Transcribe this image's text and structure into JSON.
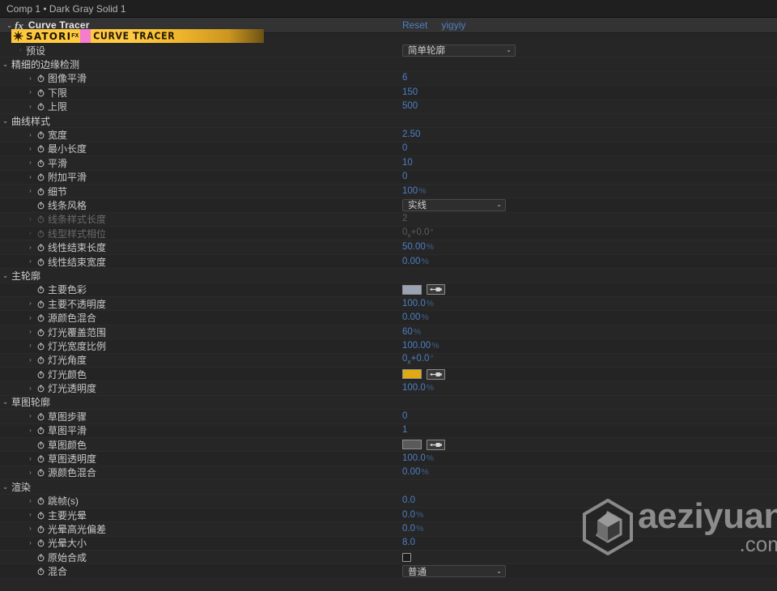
{
  "panel": {
    "title": "Comp 1 • Dark Gray Solid 1"
  },
  "effect": {
    "name": "Curve Tracer",
    "fx_glyph": "fx",
    "twirl": "⌄",
    "reset_label": "Reset",
    "author_label": "yigyiy"
  },
  "banner": {
    "brand": "SATORI",
    "brand_sup": "FX",
    "product": "CURVE TRACER",
    "gold": "#ffc83c",
    "pink": "#f47ecb"
  },
  "colors": {
    "value_blue": "#4f7fc4",
    "main_color_swatch": "#9aa3b4",
    "light_color_swatch": "#e0aa12",
    "sketch_color_swatch": "#5a5a5a"
  },
  "rows": [
    {
      "label": "预设",
      "indent": 1,
      "caret": "",
      "arrow": "",
      "stopwatch": false,
      "type": "dropdown",
      "value": "简单轮廓",
      "width": "wide"
    },
    {
      "label": "精细的边缘检测",
      "indent": 0,
      "caret": "⌄",
      "arrow": "",
      "stopwatch": false,
      "type": "group",
      "value": ""
    },
    {
      "label": "图像平滑",
      "indent": 2,
      "arrow": "›",
      "stopwatch": true,
      "type": "number",
      "value": "6"
    },
    {
      "label": "下限",
      "indent": 2,
      "arrow": "›",
      "stopwatch": true,
      "type": "number",
      "value": "150"
    },
    {
      "label": "上限",
      "indent": 2,
      "arrow": "›",
      "stopwatch": true,
      "type": "number",
      "value": "500"
    },
    {
      "label": "曲线样式",
      "indent": 0,
      "caret": "⌄",
      "arrow": "",
      "stopwatch": false,
      "type": "group",
      "value": ""
    },
    {
      "label": "宽度",
      "indent": 2,
      "arrow": "›",
      "stopwatch": true,
      "type": "number",
      "value": "2.50"
    },
    {
      "label": "最小长度",
      "indent": 2,
      "arrow": "›",
      "stopwatch": true,
      "type": "number",
      "value": "0"
    },
    {
      "label": "平滑",
      "indent": 2,
      "arrow": "›",
      "stopwatch": true,
      "type": "number",
      "value": "10"
    },
    {
      "label": "附加平滑",
      "indent": 2,
      "arrow": "›",
      "stopwatch": true,
      "type": "number",
      "value": "0"
    },
    {
      "label": "细节",
      "indent": 2,
      "arrow": "›",
      "stopwatch": true,
      "type": "percent",
      "value": "100",
      "unit": "%"
    },
    {
      "label": "线条风格",
      "indent": 2,
      "arrow": "",
      "stopwatch": true,
      "type": "dropdown",
      "value": "实线",
      "width": "med"
    },
    {
      "label": "线条样式长度",
      "indent": 2,
      "arrow": "›",
      "stopwatch": true,
      "type": "number",
      "value": "2",
      "disabled": true
    },
    {
      "label": "线型样式相位",
      "indent": 2,
      "arrow": "›",
      "stopwatch": true,
      "type": "angle",
      "value": "0x+0.0°",
      "disabled": true
    },
    {
      "label": "线性结束长度",
      "indent": 2,
      "arrow": "›",
      "stopwatch": true,
      "type": "percent",
      "value": "50.00",
      "unit": "%"
    },
    {
      "label": "线性结束宽度",
      "indent": 2,
      "arrow": "›",
      "stopwatch": true,
      "type": "percent",
      "value": "0.00",
      "unit": "%"
    },
    {
      "label": "主轮廓",
      "indent": 0,
      "caret": "⌄",
      "arrow": "",
      "stopwatch": false,
      "type": "group",
      "value": ""
    },
    {
      "label": "主要色彩",
      "indent": 2,
      "arrow": "",
      "stopwatch": true,
      "type": "color",
      "swatch": "#9aa3b4"
    },
    {
      "label": "主要不透明度",
      "indent": 2,
      "arrow": "›",
      "stopwatch": true,
      "type": "percent",
      "value": "100.0",
      "unit": "%"
    },
    {
      "label": "源颜色混合",
      "indent": 2,
      "arrow": "›",
      "stopwatch": true,
      "type": "percent",
      "value": "0.00",
      "unit": "%"
    },
    {
      "label": "灯光覆盖范围",
      "indent": 2,
      "arrow": "›",
      "stopwatch": true,
      "type": "percent",
      "value": "60",
      "unit": "%"
    },
    {
      "label": "灯光宽度比例",
      "indent": 2,
      "arrow": "›",
      "stopwatch": true,
      "type": "percent",
      "value": "100.00",
      "unit": "%"
    },
    {
      "label": "灯光角度",
      "indent": 2,
      "arrow": "›",
      "stopwatch": true,
      "type": "angle",
      "value": "0x+0.0°"
    },
    {
      "label": "灯光颜色",
      "indent": 2,
      "arrow": "",
      "stopwatch": true,
      "type": "color",
      "swatch": "#e0aa12"
    },
    {
      "label": "灯光透明度",
      "indent": 2,
      "arrow": "›",
      "stopwatch": true,
      "type": "percent",
      "value": "100.0",
      "unit": "%"
    },
    {
      "label": "草图轮廓",
      "indent": 0,
      "caret": "⌄",
      "arrow": "",
      "stopwatch": false,
      "type": "group",
      "value": ""
    },
    {
      "label": "草图步骤",
      "indent": 2,
      "arrow": "›",
      "stopwatch": true,
      "type": "number",
      "value": "0"
    },
    {
      "label": "草图平滑",
      "indent": 2,
      "arrow": "›",
      "stopwatch": true,
      "type": "number",
      "value": "1"
    },
    {
      "label": "草图颜色",
      "indent": 2,
      "arrow": "",
      "stopwatch": true,
      "type": "color",
      "swatch": "#5a5a5a"
    },
    {
      "label": "草图透明度",
      "indent": 2,
      "arrow": "›",
      "stopwatch": true,
      "type": "percent",
      "value": "100.0",
      "unit": "%"
    },
    {
      "label": "源颜色混合",
      "indent": 2,
      "arrow": "›",
      "stopwatch": true,
      "type": "percent",
      "value": "0.00",
      "unit": "%"
    },
    {
      "label": "渲染",
      "indent": 0,
      "caret": "⌄",
      "arrow": "",
      "stopwatch": false,
      "type": "group",
      "value": ""
    },
    {
      "label": "跳帧(s)",
      "indent": 2,
      "arrow": "›",
      "stopwatch": true,
      "type": "number",
      "value": "0.0"
    },
    {
      "label": "主要光晕",
      "indent": 2,
      "arrow": "›",
      "stopwatch": true,
      "type": "percent",
      "value": "0.0",
      "unit": "%"
    },
    {
      "label": "光晕高光偏差",
      "indent": 2,
      "arrow": "›",
      "stopwatch": true,
      "type": "percent",
      "value": "0.0",
      "unit": "%"
    },
    {
      "label": "光晕大小",
      "indent": 2,
      "arrow": "›",
      "stopwatch": true,
      "type": "number",
      "value": "8.0"
    },
    {
      "label": "原始合成",
      "indent": 2,
      "arrow": "",
      "stopwatch": true,
      "type": "checkbox",
      "checked": false
    },
    {
      "label": "混合",
      "indent": 2,
      "arrow": "",
      "stopwatch": true,
      "type": "dropdown",
      "value": "普通",
      "width": "med"
    }
  ],
  "watermark": {
    "name": "aeziyuan",
    "tld": ".com"
  }
}
